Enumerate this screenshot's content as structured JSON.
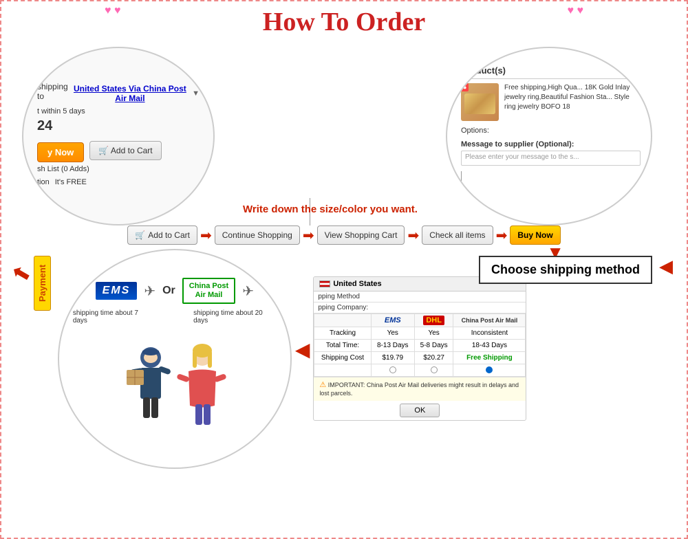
{
  "page": {
    "title": "How To Order",
    "border_color": "#e88888"
  },
  "hearts": {
    "top_left": "♥ ♥",
    "top_right": "♥ ♥",
    "bottom_left": "♥",
    "bottom_right": "♥"
  },
  "top_left_circle": {
    "shipping_prefix": "shipping to",
    "shipping_link": "United States Via China Post Air Mail",
    "dropdown_icon": "▼",
    "within_days": "t within 5 days",
    "price": "24",
    "buy_now": "y Now",
    "add_to_cart": "Add to Cart",
    "wish_list": "sh List (0 Adds)",
    "protection": "tion",
    "free_text": "It's FREE"
  },
  "top_right_circle": {
    "header": "Product(s)",
    "product_badge": "●",
    "product_description": "Free shipping,High Qua... 18K Gold Inlay jewelry ring,Beautiful Fashion Sta... Style ring jewelry BOFO 18",
    "options_label": "Options:",
    "message_header": "Message to supplier (Optional):",
    "message_placeholder": "Please enter your message to the s..."
  },
  "write_down_text": "Write down the size/color you want.",
  "flow_steps": [
    {
      "id": "add-to-cart",
      "label": "Add to Cart",
      "has_cart_icon": true
    },
    {
      "id": "continue-shopping",
      "label": "Continue Shopping"
    },
    {
      "id": "view-cart",
      "label": "View Shopping Cart"
    },
    {
      "id": "check-items",
      "label": "Check all items"
    },
    {
      "id": "buy-now",
      "label": "Buy Now",
      "is_highlight": true
    }
  ],
  "arrows": {
    "flow": "➡",
    "down_red": "▼",
    "left_red": "◀",
    "diagonal_red": "↙"
  },
  "choose_shipping": {
    "label": "Choose shipping method"
  },
  "payment_label": "Payment",
  "bottom_left_circle": {
    "ems_label": "EMS",
    "or_text": "Or",
    "china_post_label": "China Post\nAir Mail",
    "shipping_time_ems": "shipping time about 7 days",
    "shipping_time_china_post": "shipping time about 20 days"
  },
  "shipping_table": {
    "header": "United States",
    "method_label": "pping Method",
    "company_label": "pping Company:",
    "columns": [
      "EMS",
      "DHL",
      "China Post Air Mail"
    ],
    "rows": [
      {
        "label": "Tracking",
        "values": [
          "Yes",
          "Yes",
          "Inconsistent"
        ]
      },
      {
        "label": "Total Time:",
        "values": [
          "8-13 Days",
          "5-8 Days",
          "18-43 Days"
        ]
      },
      {
        "label": "Shipping Cost",
        "values": [
          "$19.79",
          "$20.27",
          "Free Shipping"
        ]
      },
      {
        "label": "",
        "values": [
          "radio",
          "radio",
          "radio_selected"
        ]
      }
    ],
    "important_note": "IMPORTANT: China Post Air Mail deliveries might result in delays and lost parcels.",
    "ok_button": "OK"
  }
}
